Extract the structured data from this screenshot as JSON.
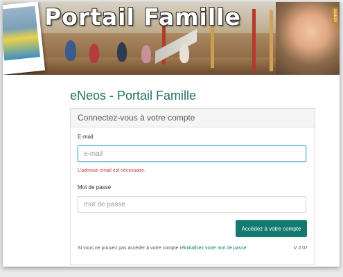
{
  "banner": {
    "title": "Portail Famille",
    "side_tag": "AGEDI"
  },
  "page": {
    "app_title": "eNeos - Portail Famille"
  },
  "login_panel": {
    "heading": "Connectez-vous à votre compte",
    "email": {
      "label": "E-mail",
      "placeholder": "e-mail",
      "value": "",
      "error": "L'adresse email est nécessaire."
    },
    "password": {
      "label": "Mot de passe",
      "placeholder": "mot de passe",
      "value": ""
    },
    "submit_label": "Accédez à votre compte",
    "footer": {
      "text": "Si vous ne pouvez pas accéder à votre compte",
      "link_text": "réinitialisez votre mot de passe",
      "version": "V 2.07"
    }
  },
  "colors": {
    "accent": "#137a71",
    "title": "#1f6f66",
    "error": "#c0392b"
  }
}
